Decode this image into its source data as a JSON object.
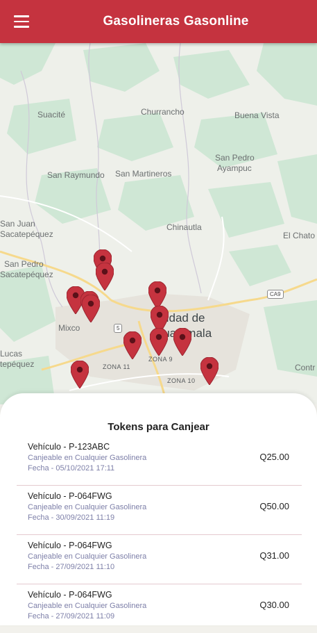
{
  "header": {
    "title": "Gasolineras Gasonline",
    "menu_icon": "hamburger-menu-icon"
  },
  "map": {
    "places": [
      "Suacité",
      "Churrancho",
      "Buena Vista",
      "San Pedro",
      "Ayampuc",
      "San Raymundo",
      "San Martineros",
      "San Juan",
      "Sacatepéquez",
      "Chinautla",
      "El Chato",
      "San Pedro",
      "Sacatepéquez",
      "Mixco",
      "Ciudad de",
      "Guatemala",
      "Lucas",
      "tepéquez",
      "Contr"
    ],
    "zones": [
      "ZONA 11",
      "ZONA 9",
      "ZONA 10"
    ],
    "road_shields": [
      "CA9",
      "5"
    ],
    "pin_color": "#c5333f",
    "pin_count": 14
  },
  "tokens": {
    "title": "Tokens para Canjear",
    "items": [
      {
        "vehicle": "Vehículo - P-123ABC",
        "redeem": "Canjeable en Cualquier Gasolinera",
        "date": "Fecha - 05/10/2021 17:11",
        "amount": "Q25.00"
      },
      {
        "vehicle": "Vehículo - P-064FWG",
        "redeem": "Canjeable en Cualquier Gasolinera",
        "date": "Fecha - 30/09/2021 11:19",
        "amount": "Q50.00"
      },
      {
        "vehicle": "Vehículo - P-064FWG",
        "redeem": "Canjeable en Cualquier Gasolinera",
        "date": "Fecha - 27/09/2021 11:10",
        "amount": "Q31.00"
      },
      {
        "vehicle": "Vehículo - P-064FWG",
        "redeem": "Canjeable en Cualquier Gasolinera",
        "date": "Fecha - 27/09/2021 11:09",
        "amount": "Q30.00"
      }
    ]
  },
  "colors": {
    "accent": "#c5333f",
    "secondary_text": "#7d7fa8"
  }
}
